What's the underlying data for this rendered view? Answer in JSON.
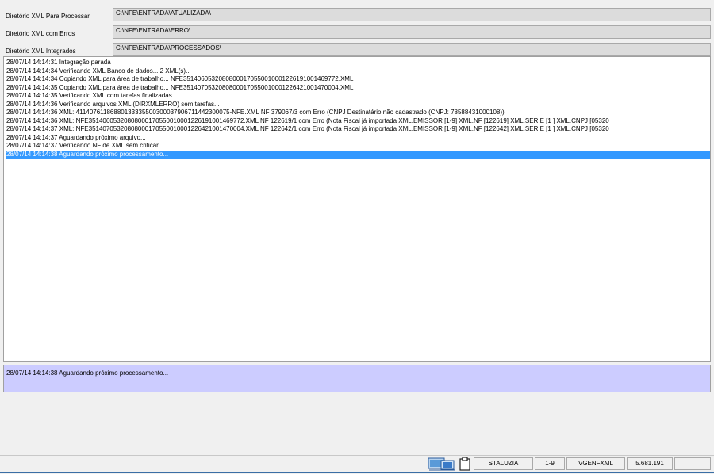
{
  "dirs": [
    {
      "label": "Diretório XML Para Processar",
      "value": "C:\\NFE\\ENTRADA\\ATUALIZADA\\"
    },
    {
      "label": "Diretório XML com Erros",
      "value": "C:\\NFE\\ENTRADA\\ERRO\\"
    },
    {
      "label": "Diretório XML Integrados",
      "value": "C:\\NFE\\ENTRADA\\PROCESSADOS\\"
    }
  ],
  "log": [
    "28/07/14 14:14:31 Integração parada",
    "28/07/14 14:14:34 Verificando XML Banco de dados... 2 XML(s)...",
    "28/07/14 14:14:34 Copiando XML para área de trabalho... NFE35140605320808000170550010001226191001469772.XML",
    "28/07/14 14:14:35 Copiando XML para área de trabalho... NFE35140705320808000170550010001226421001470004.XML",
    "28/07/14 14:14:35 Verificando XML com tarefas finalizadas...",
    "28/07/14 14:14:36 Verificando arquivos XML (DIRXMLERRO) sem tarefas...",
    "28/07/14 14:14:36 XML: 41140761186880133335500300037906711442300075-NFE.XML NF 379067/3 com Erro (CNPJ Destinatário não cadastrado (CNPJ: 78588431000108))",
    "28/07/14 14:14:36 XML: NFE35140605320808000170550010001226191001469772.XML NF 122619/1 com Erro (Nota Fiscal já importada XML.EMISSOR [1-9] XML.NF [122619] XML.SERIE [1  ] XML.CNPJ [05320",
    "28/07/14 14:14:37 XML: NFE35140705320808000170550010001226421001470004.XML NF 122642/1 com Erro (Nota Fiscal já importada XML.EMISSOR [1-9] XML.NF [122642] XML.SERIE [1  ] XML.CNPJ [05320",
    "28/07/14 14:14:37 Aguardando próximo arquivo...",
    "28/07/14 14:14:37 Verificando NF de XML sem criticar...",
    "28/07/14 14:14:38 Aguardando próximo processamento..."
  ],
  "selected_index": 11,
  "status_message": "28/07/14 14:14:38 Aguardando próximo processamento...",
  "statusbar": {
    "icons": [
      "network-icon",
      "clipboard-icon"
    ],
    "user": "STALUZIA",
    "branch": "1-9",
    "program": "VGENFXML",
    "version": "5.681.191"
  },
  "colors": {
    "selection": "#3399ff",
    "status_panel": "#ccccff"
  }
}
